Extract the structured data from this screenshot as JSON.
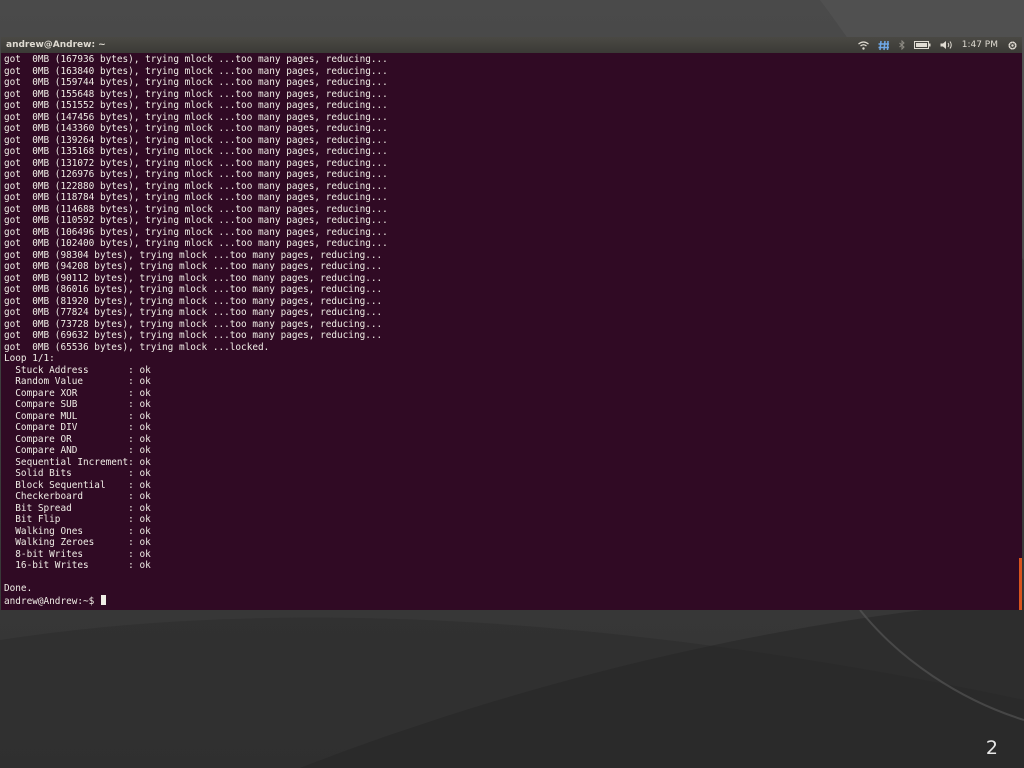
{
  "topbar": {
    "window_title": "andrew@Andrew: ~",
    "clock": "1:47 PM",
    "icons": [
      "wifi-icon",
      "keyboard-layout-icon",
      "bluetooth-icon",
      "battery-icon",
      "volume-icon",
      "gear-icon"
    ]
  },
  "terminal": {
    "lines": [
      "got  0MB (167936 bytes), trying mlock ...too many pages, reducing...",
      "got  0MB (163840 bytes), trying mlock ...too many pages, reducing...",
      "got  0MB (159744 bytes), trying mlock ...too many pages, reducing...",
      "got  0MB (155648 bytes), trying mlock ...too many pages, reducing...",
      "got  0MB (151552 bytes), trying mlock ...too many pages, reducing...",
      "got  0MB (147456 bytes), trying mlock ...too many pages, reducing...",
      "got  0MB (143360 bytes), trying mlock ...too many pages, reducing...",
      "got  0MB (139264 bytes), trying mlock ...too many pages, reducing...",
      "got  0MB (135168 bytes), trying mlock ...too many pages, reducing...",
      "got  0MB (131072 bytes), trying mlock ...too many pages, reducing...",
      "got  0MB (126976 bytes), trying mlock ...too many pages, reducing...",
      "got  0MB (122880 bytes), trying mlock ...too many pages, reducing...",
      "got  0MB (118784 bytes), trying mlock ...too many pages, reducing...",
      "got  0MB (114688 bytes), trying mlock ...too many pages, reducing...",
      "got  0MB (110592 bytes), trying mlock ...too many pages, reducing...",
      "got  0MB (106496 bytes), trying mlock ...too many pages, reducing...",
      "got  0MB (102400 bytes), trying mlock ...too many pages, reducing...",
      "got  0MB (98304 bytes), trying mlock ...too many pages, reducing...",
      "got  0MB (94208 bytes), trying mlock ...too many pages, reducing...",
      "got  0MB (90112 bytes), trying mlock ...too many pages, reducing...",
      "got  0MB (86016 bytes), trying mlock ...too many pages, reducing...",
      "got  0MB (81920 bytes), trying mlock ...too many pages, reducing...",
      "got  0MB (77824 bytes), trying mlock ...too many pages, reducing...",
      "got  0MB (73728 bytes), trying mlock ...too many pages, reducing...",
      "got  0MB (69632 bytes), trying mlock ...too many pages, reducing...",
      "got  0MB (65536 bytes), trying mlock ...locked.",
      "Loop 1/1:",
      "  Stuck Address       : ok",
      "  Random Value        : ok",
      "  Compare XOR         : ok",
      "  Compare SUB         : ok",
      "  Compare MUL         : ok",
      "  Compare DIV         : ok",
      "  Compare OR          : ok",
      "  Compare AND         : ok",
      "  Sequential Increment: ok",
      "  Solid Bits          : ok",
      "  Block Sequential    : ok",
      "  Checkerboard        : ok",
      "  Bit Spread          : ok",
      "  Bit Flip            : ok",
      "  Walking Ones        : ok",
      "  Walking Zeroes      : ok",
      "  8-bit Writes        : ok",
      "  16-bit Writes       : ok",
      "",
      "Done."
    ],
    "prompt": "andrew@Andrew:~$ "
  },
  "slide": {
    "page_number": "2"
  },
  "colors": {
    "terminal_background": "#300a24",
    "terminal_text": "#f0ede6",
    "topbar_background": "#3b3a36",
    "scrollbar_accent": "#d9541e"
  }
}
